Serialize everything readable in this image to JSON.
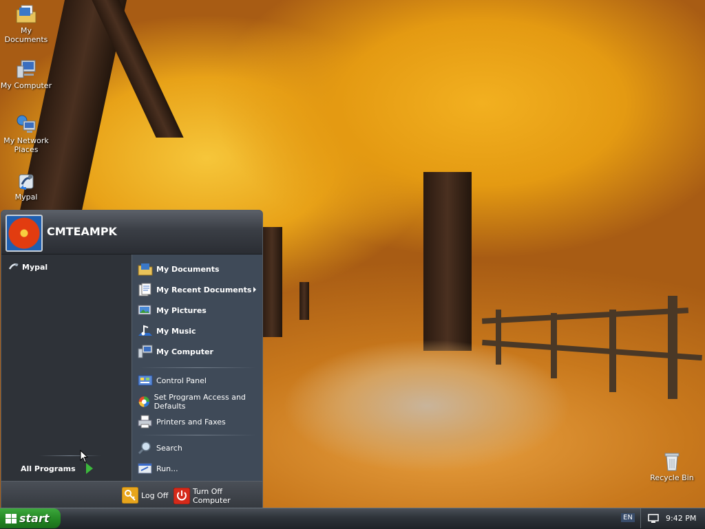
{
  "desktop": {
    "icons": [
      {
        "label": "My Documents",
        "icon": "folder-icon"
      },
      {
        "label": "My Computer",
        "icon": "computer-icon"
      },
      {
        "label": "My Network Places",
        "icon": "network-icon"
      },
      {
        "label": "Mypal",
        "icon": "browser-shortcut-icon"
      },
      {
        "label": "Recycle Bin",
        "icon": "recycle-bin-icon"
      }
    ]
  },
  "start_menu": {
    "user_name": "CMTEAMPK",
    "pinned": [
      {
        "label": "Mypal",
        "icon": "browser-icon"
      }
    ],
    "all_programs_label": "All Programs",
    "places": [
      {
        "label": "My Documents",
        "icon": "folder-icon"
      },
      {
        "label": "My Recent Documents",
        "icon": "recent-documents-icon",
        "has_submenu": true
      },
      {
        "label": "My Pictures",
        "icon": "pictures-icon"
      },
      {
        "label": "My Music",
        "icon": "music-icon"
      },
      {
        "label": "My Computer",
        "icon": "computer-icon"
      }
    ],
    "system": [
      {
        "label": "Control Panel",
        "icon": "control-panel-icon"
      },
      {
        "label": "Set Program Access and Defaults",
        "icon": "program-defaults-icon"
      },
      {
        "label": "Printers and Faxes",
        "icon": "printer-icon"
      }
    ],
    "tools": [
      {
        "label": "Search",
        "icon": "search-icon"
      },
      {
        "label": "Run...",
        "icon": "run-icon"
      }
    ],
    "footer": {
      "log_off_label": "Log Off",
      "turn_off_label": "Turn Off Computer"
    }
  },
  "taskbar": {
    "start_label": "start",
    "language": "EN",
    "clock": "9:42 PM"
  },
  "colors": {
    "taskbar": "#2e3339",
    "start_button": "#268a26",
    "menu_left": "#2e3238",
    "menu_right": "#3f4a58"
  }
}
